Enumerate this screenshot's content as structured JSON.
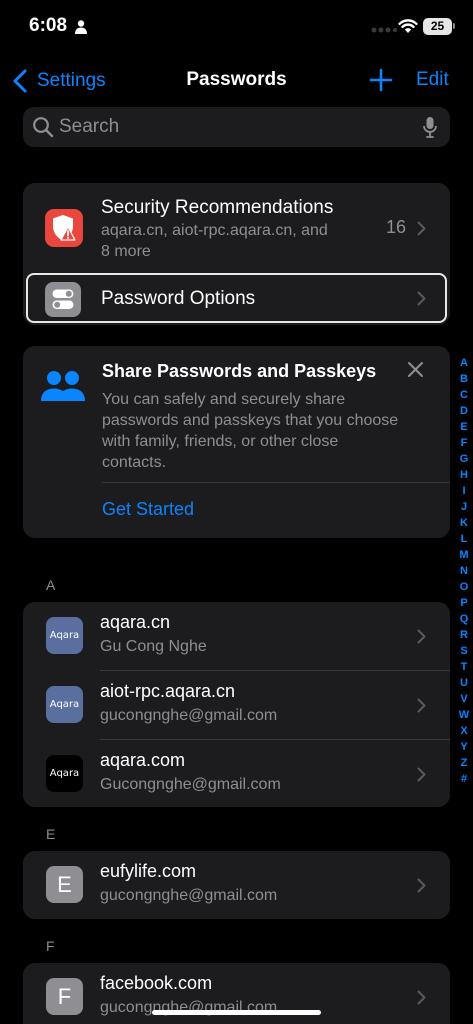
{
  "status_bar": {
    "time": "6:08",
    "battery": "25"
  },
  "nav": {
    "back_label": "Settings",
    "title": "Passwords",
    "edit_label": "Edit"
  },
  "search": {
    "placeholder": "Search"
  },
  "security": {
    "title": "Security Recommendations",
    "subtitle_line1": "aqara.cn, aiot-rpc.aqara.cn, and",
    "subtitle_line2": "8 more",
    "count": "16"
  },
  "options": {
    "label": "Password Options"
  },
  "share": {
    "title": "Share Passwords and Passkeys",
    "body": "You can safely and securely share passwords and passkeys that you choose with family, friends, or other close contacts.",
    "action": "Get Started"
  },
  "sections": [
    {
      "header": "A",
      "items": [
        {
          "site": "aqara.cn",
          "user": "Gu Cong Nghe",
          "icon_text": "Aqara"
        },
        {
          "site": "aiot-rpc.aqara.cn",
          "user": "gucongnghe@gmail.com",
          "icon_text": "Aqara"
        },
        {
          "site": "aqara.com",
          "user": "Gucongnghe@gmail.com",
          "icon_text": "Aqara"
        }
      ]
    },
    {
      "header": "E",
      "items": [
        {
          "site": "eufylife.com",
          "user": "gucongnghe@gmail.com",
          "icon_text": "E"
        }
      ]
    },
    {
      "header": "F",
      "items": [
        {
          "site": "facebook.com",
          "user": "gucongnghe@gmail.com",
          "icon_text": "F"
        }
      ]
    }
  ],
  "index_letters": [
    "A",
    "B",
    "C",
    "D",
    "E",
    "F",
    "G",
    "H",
    "I",
    "J",
    "K",
    "L",
    "M",
    "N",
    "O",
    "P",
    "Q",
    "R",
    "S",
    "T",
    "U",
    "V",
    "W",
    "X",
    "Y",
    "Z",
    "#"
  ],
  "colors": {
    "accent": "#0a84ff",
    "security_tile": "#e9473e",
    "background": "#000000",
    "card": "#1c1c1e"
  }
}
